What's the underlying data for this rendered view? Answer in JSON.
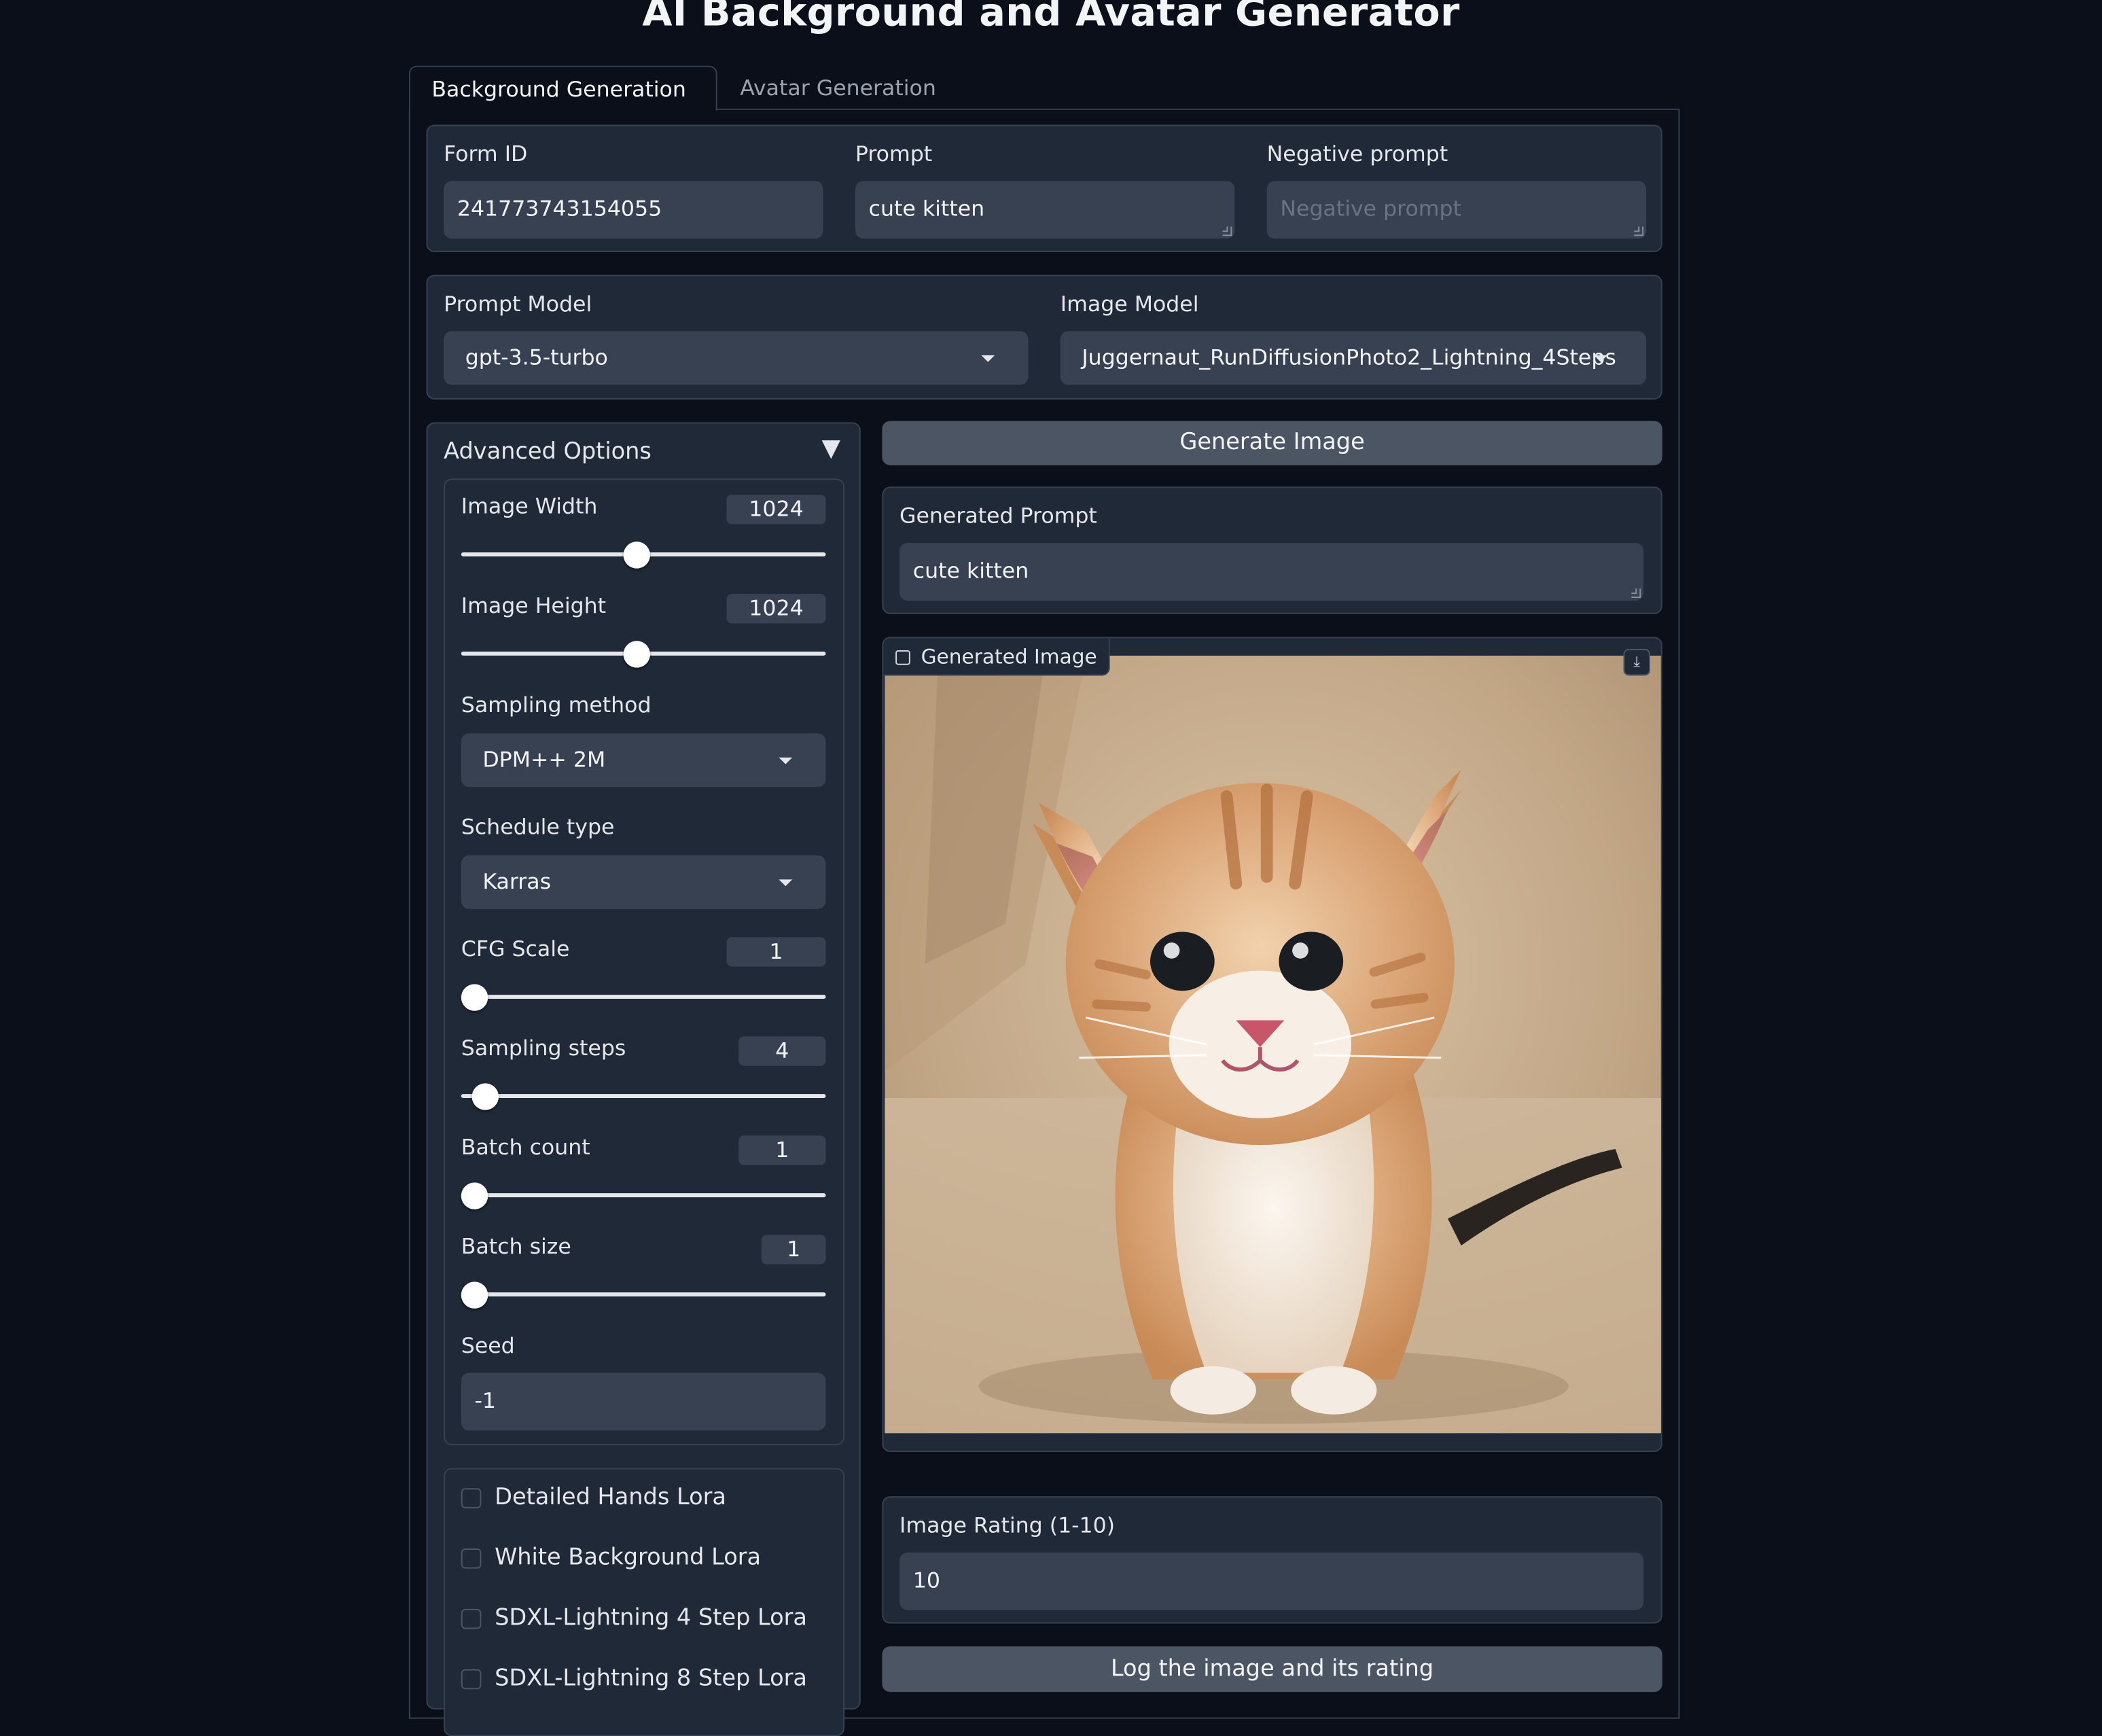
{
  "app": {
    "title": "AI Background and Avatar Generator"
  },
  "tabs": [
    {
      "label": "Background Generation",
      "active": true
    },
    {
      "label": "Avatar Generation",
      "active": false
    }
  ],
  "form": {
    "form_id_label": "Form ID",
    "form_id_value": "241773743154055",
    "prompt_label": "Prompt",
    "prompt_value": "cute kitten",
    "negative_prompt_label": "Negative prompt",
    "negative_prompt_placeholder": "Negative prompt"
  },
  "models": {
    "prompt_model_label": "Prompt Model",
    "prompt_model_value": "gpt-3.5-turbo",
    "image_model_label": "Image Model",
    "image_model_value": "Juggernaut_RunDiffusionPhoto2_Lightning_4Steps"
  },
  "advanced": {
    "title": "Advanced Options",
    "toggle_icon": "▼",
    "image_width_label": "Image Width",
    "image_width_value": "1024",
    "image_width_fraction": 0.48,
    "image_height_label": "Image Height",
    "image_height_value": "1024",
    "image_height_fraction": 0.48,
    "sampling_method_label": "Sampling method",
    "sampling_method_value": "DPM++ 2M",
    "schedule_type_label": "Schedule type",
    "schedule_type_value": "Karras",
    "cfg_scale_label": "CFG Scale",
    "cfg_scale_value": "1",
    "cfg_scale_fraction": 0.0,
    "sampling_steps_label": "Sampling steps",
    "sampling_steps_value": "4",
    "sampling_steps_fraction": 0.03,
    "batch_count_label": "Batch count",
    "batch_count_value": "1",
    "batch_count_fraction": 0.0,
    "batch_size_label": "Batch size",
    "batch_size_value": "1",
    "batch_size_fraction": 0.0,
    "seed_label": "Seed",
    "seed_value": "-1"
  },
  "loras": [
    {
      "label": "Detailed Hands Lora",
      "checked": false
    },
    {
      "label": "White Background Lora",
      "checked": false
    },
    {
      "label": "SDXL-Lightning 4 Step Lora",
      "checked": false
    },
    {
      "label": "SDXL-Lightning 8 Step Lora",
      "checked": false
    }
  ],
  "output": {
    "generate_button": "Generate Image",
    "generated_prompt_label": "Generated Prompt",
    "generated_prompt_value": "cute kitten",
    "generated_image_label": "Generated Image",
    "image_rating_label": "Image Rating (1-10)",
    "image_rating_value": "10",
    "log_button": "Log the image and its rating"
  },
  "icons": {
    "download": "download-icon",
    "image": "image-icon",
    "dropdown": "chevron-down-icon"
  },
  "colors": {
    "background": "#0b0f19",
    "panel": "#1f2937",
    "input": "#374151",
    "button": "#4b5563"
  }
}
